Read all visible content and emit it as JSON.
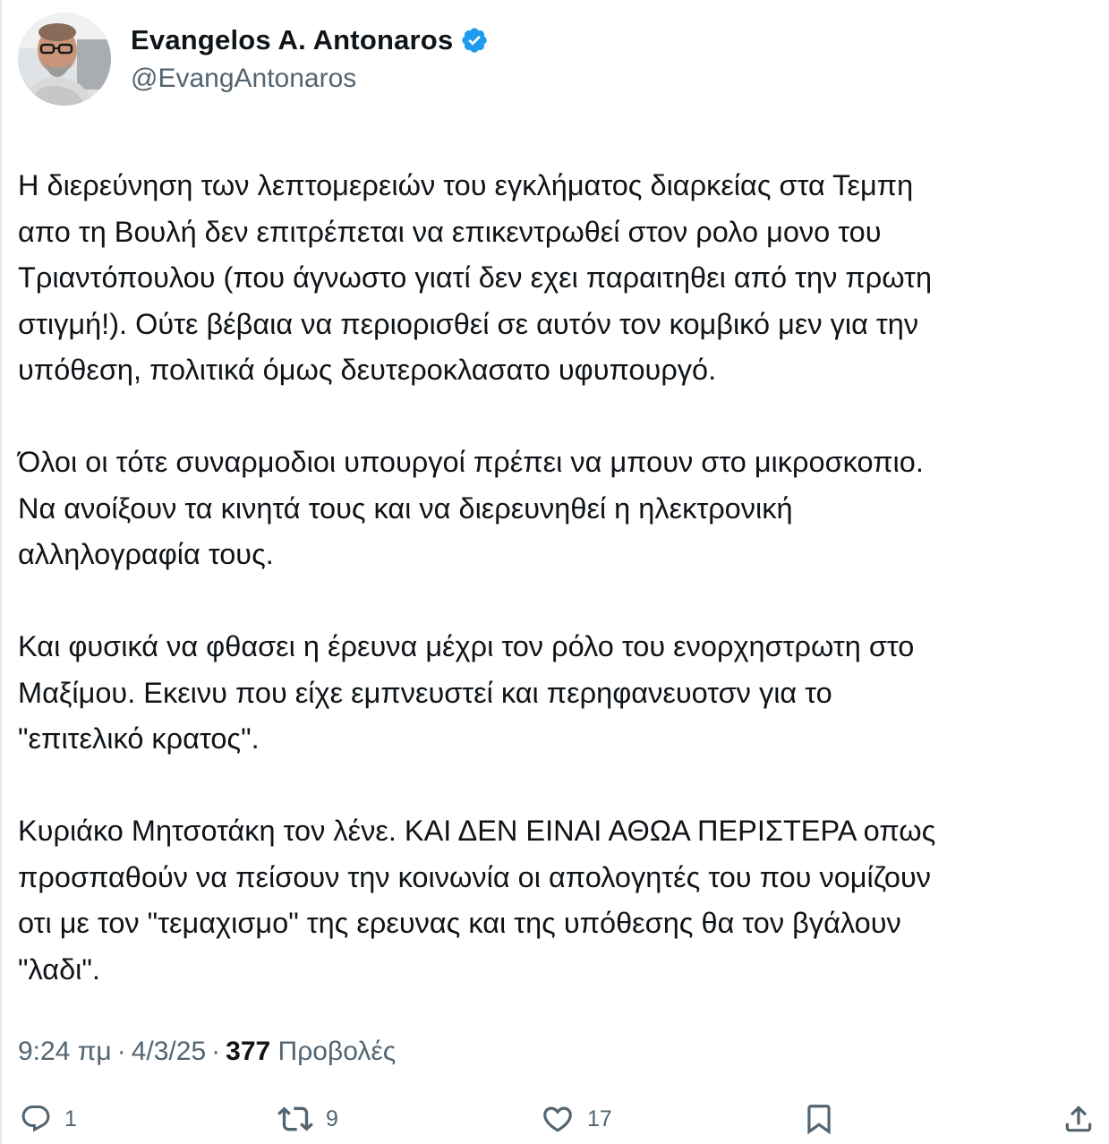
{
  "author": {
    "display_name": "Evangelos A. Antonaros",
    "handle": "@EvangAntonaros",
    "verified": true,
    "verified_color": "#1d9bf0",
    "avatar_icon": "profile-photo"
  },
  "tweet": {
    "paragraphs": [
      "Η διερεύνηση των λεπτομερειών του εγκλήματος διαρκείας στα Τεμπη\nαπο τη Βουλή  δεν επιτρέπεται να επικεντρωθεί στον ρολο μονο του\nΤριαντόπουλου (που άγνωστο γιατί δεν εχει παραιτηθει από την πρωτη\nστιγμή!). Ούτε βέβαια να περιορισθεί σε αυτόν τον κομβικό μεν για την\nυπόθεση, πολιτικά όμως δευτεροκλασατο υφυπουργό.",
      "Όλοι οι τότε συναρμοδιοι  υπουργοί πρέπει να μπουν στο μικροσκοπιο.\nΝα ανοίξουν τα κινητά τους και να διερευνηθεί η ηλεκτρονική\nαλληλογραφία τους.",
      "Και φυσικά να φθασει η έρευνα μέχρι τον ρόλο του ενορχηστρωτη στο\nΜαξίμου. Εκεινυ που είχε εμπνευστεί και περηφανευοτσν για το\n\"επιτελικό κρατος\".",
      "Κυριάκο Μητσοτάκη τον λένε. ΚΑΙ ΔΕΝ ΕΙΝΑΙ ΑΘΩΑ ΠΕΡΙΣΤΕΡΑ οπως\nπροσπαθούν να πείσουν την κοινωνία οι απολογητές του που νομίζουν\nοτι με τον \"τεμαχισμο\" της ερευνας και της υπόθεσης θα τον βγάλουν\n\"λαδι\"."
    ]
  },
  "meta": {
    "time": "9:24 πμ",
    "date": "4/3/25",
    "separator": "·",
    "views_count": "377",
    "views_label": "Προβολές"
  },
  "actions": {
    "reply": {
      "icon": "reply-icon",
      "count": "1"
    },
    "repost": {
      "icon": "repost-icon",
      "count": "9"
    },
    "like": {
      "icon": "like-icon",
      "count": "17"
    },
    "bookmark": {
      "icon": "bookmark-icon"
    },
    "share": {
      "icon": "share-icon"
    }
  },
  "colors": {
    "text": "#0f1419",
    "secondary": "#536471",
    "verified": "#1d9bf0"
  }
}
